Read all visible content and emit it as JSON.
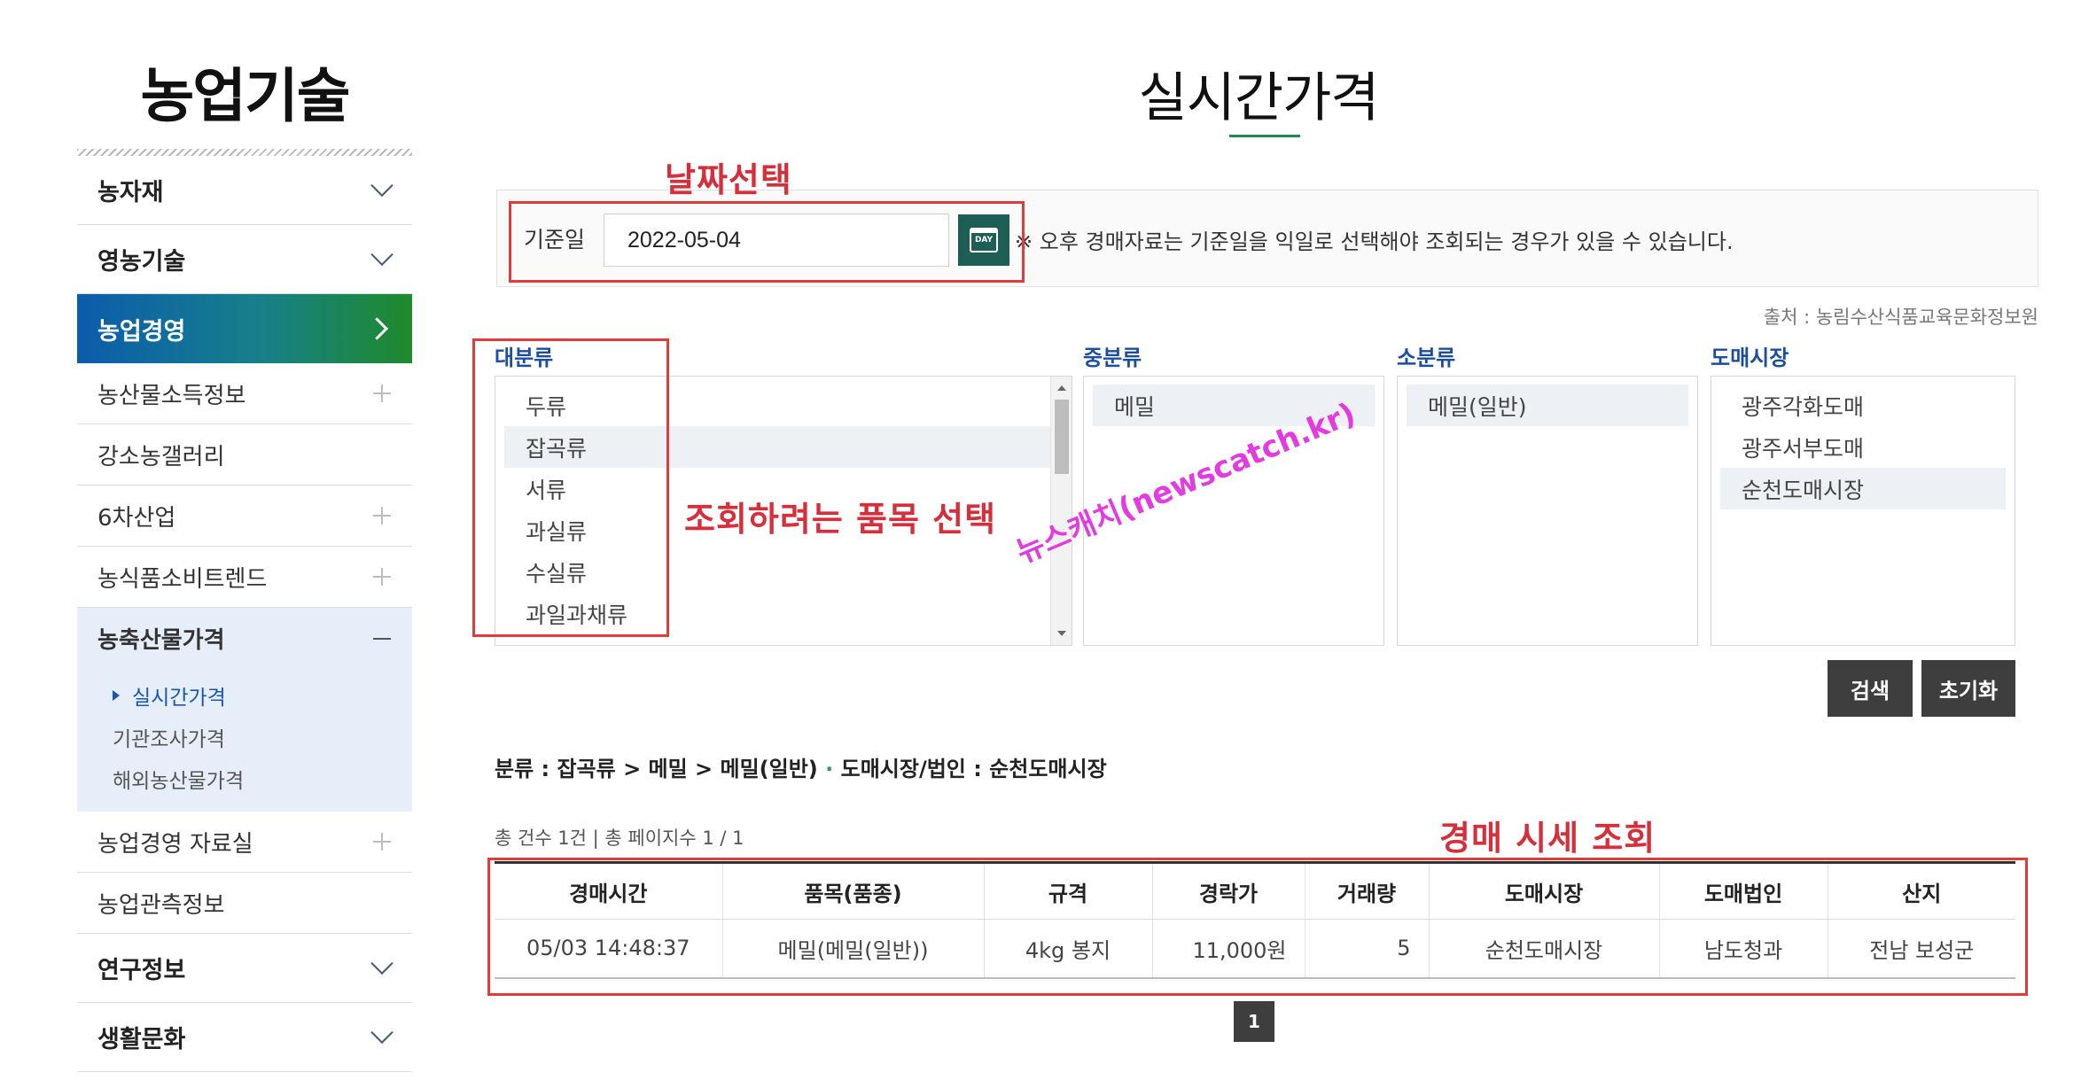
{
  "sidebar": {
    "title": "농업기술",
    "items": [
      {
        "label": "농자재"
      },
      {
        "label": "영농기술"
      },
      {
        "label": "농업경영"
      },
      {
        "label": "농산물소득정보"
      },
      {
        "label": "강소농갤러리"
      },
      {
        "label": "6차산업"
      },
      {
        "label": "농식품소비트렌드"
      },
      {
        "label": "농축산물가격"
      },
      {
        "label": "농업경영 자료실"
      },
      {
        "label": "농업관측정보"
      },
      {
        "label": "연구정보"
      },
      {
        "label": "생활문화"
      }
    ],
    "submenu": [
      {
        "label": "실시간가격"
      },
      {
        "label": "기관조사가격"
      },
      {
        "label": "해외농산물가격"
      }
    ]
  },
  "page": {
    "title": "실시간가격",
    "source": "출처 : 농림수산식품교육문화정보원"
  },
  "date": {
    "label": "기준일",
    "value": "2022-05-04",
    "day_icon_text": "DAY",
    "note": "※ 오후 경매자료는 기준일을 익일로 선택해야 조회되는 경우가 있을 수 있습니다."
  },
  "categories": {
    "major": {
      "header": "대분류",
      "items": [
        "두류",
        "잡곡류",
        "서류",
        "과실류",
        "수실류",
        "과일과채류"
      ],
      "selected": "잡곡류"
    },
    "middle": {
      "header": "중분류",
      "items": [
        "메밀"
      ],
      "selected": "메밀"
    },
    "minor": {
      "header": "소분류",
      "items": [
        "메밀(일반)"
      ],
      "selected": "메밀(일반)"
    },
    "market": {
      "header": "도매시장",
      "items": [
        "광주각화도매",
        "광주서부도매",
        "순천도매시장"
      ],
      "selected": "순천도매시장"
    }
  },
  "buttons": {
    "search": "검색",
    "reset": "초기화"
  },
  "breadcrumb": {
    "text": "분류 : 잡곡류 > 메밀 > 메밀(일반)",
    "dot": "·",
    "market_text": "도매시장/법인 : 순천도매시장"
  },
  "summary": "총 건수 1건 | 총 페이지수 1 / 1",
  "table": {
    "headers": [
      "경매시간",
      "품목(품종)",
      "규격",
      "경락가",
      "거래량",
      "도매시장",
      "도매법인",
      "산지"
    ],
    "rows": [
      [
        "05/03 14:48:37",
        "메밀(메밀(일반))",
        "4kg 봉지",
        "11,000원",
        "5",
        "순천도매시장",
        "남도청과",
        "전남 보성군"
      ]
    ]
  },
  "pagination": {
    "current": "1"
  },
  "annotations": {
    "date_select": "날짜선택",
    "item_select": "조회하려는 품목 선택",
    "price_lookup": "경매 시세 조회",
    "watermark": "뉴스캐치(newscatch.kr)"
  },
  "colors": {
    "accent_blue": "#0b5cab",
    "accent_green": "#1f8a2a",
    "annotation_red": "#e03c3c",
    "watermark_pink": "#e23be0"
  }
}
